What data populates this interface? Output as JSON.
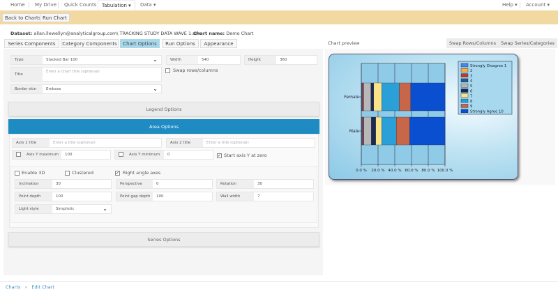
{
  "nav": {
    "items": [
      "Home",
      "My Drive",
      "Quick Counts",
      "Tabulation ▾",
      "Data ▾"
    ],
    "right": [
      "Help ▾",
      "Account ▾"
    ]
  },
  "toolbar": {
    "back": "Back to Charts",
    "run": "Run Chart"
  },
  "info": {
    "dataset_label": "Dataset:",
    "dataset": "allan.llewellyn@analyticalgroup.com\\ TRACKING STUDY DATA WAVE 1.sav",
    "chart_name_label": "Chart name:",
    "chart_name": "Demo Chart"
  },
  "tabs": [
    "Series Components",
    "Category Components",
    "Chart Options",
    "Run Options",
    "Appearance"
  ],
  "form": {
    "type_label": "Type",
    "type_value": "Stacked Bar 100",
    "width_label": "Width",
    "width_value": "540",
    "height_label": "Height",
    "height_value": "360",
    "title_label": "Title",
    "title_placeholder": "Enter a chart title (optional)",
    "swap_label": "Swap rows/columns",
    "border_label": "Border skin",
    "border_value": "Emboss"
  },
  "sections": {
    "legend": "Legend Options",
    "area": "Area Options",
    "series": "Series Options"
  },
  "area": {
    "axis1_label": "Axis 1 title",
    "axis1_placeholder": "Enter a title (optional)",
    "axis2_label": "Axis 2 title",
    "axis2_placeholder": "Enter a title (optional)",
    "ymax_label": "Axis Y maximum",
    "ymax_value": "100",
    "ymin_label": "Axis Y minimum",
    "ymin_value": "0",
    "start_zero_label": "Start axis Y at zero",
    "enable3d": "Enable 3D",
    "clustered": "Clustered",
    "right_angle": "Right angle axes",
    "inclination_label": "Inclination",
    "inclination": "30",
    "perspective_label": "Perspective",
    "perspective": "0",
    "rotation_label": "Rotation",
    "rotation": "30",
    "point_depth_label": "Point depth",
    "point_depth": "100",
    "gap_depth_label": "Point gap depth",
    "gap_depth": "100",
    "wall_width_label": "Wall width",
    "wall_width": "7",
    "light_label": "Light style",
    "light": "Simplistic"
  },
  "preview": {
    "label": "Chart preview",
    "swap_rc": "Swap Rows/Columns",
    "swap_sc": "Swap Series/Categories"
  },
  "breadcrumb": {
    "root": "Charts",
    "sep": "»",
    "current": "Edit Chart"
  },
  "chart_data": {
    "type": "bar",
    "stacked": "100%",
    "orientation": "horizontal",
    "categories": [
      "Female",
      "Male"
    ],
    "xlim": [
      0,
      100
    ],
    "ticks": [
      "0.0 %",
      "20.0 %",
      "40.0 %",
      "60.0 %",
      "80.0 %",
      "100.0 %"
    ],
    "legend_position": "top-right",
    "series": [
      {
        "name": "Strongly Disagree 1",
        "color": "#4a86e8",
        "values": [
          0.5,
          0.5
        ]
      },
      {
        "name": "2",
        "color": "#f5b041",
        "values": [
          0.3,
          0.3
        ]
      },
      {
        "name": "3",
        "color": "#c0392b",
        "values": [
          1.2,
          1.2
        ]
      },
      {
        "name": "4",
        "color": "#1f5f8b",
        "values": [
          0.8,
          1.0
        ]
      },
      {
        "name": "5",
        "color": "#b8b8b8",
        "values": [
          8.7,
          9.0
        ]
      },
      {
        "name": "6",
        "color": "#1b2a4e",
        "values": [
          3.4,
          5.3
        ]
      },
      {
        "name": "7",
        "color": "#fbe38a",
        "values": [
          9.5,
          7.0
        ]
      },
      {
        "name": "8",
        "color": "#2a9fd8",
        "values": [
          21.0,
          17.6
        ]
      },
      {
        "name": "9",
        "color": "#c8664a",
        "values": [
          13.5,
          16.0
        ]
      },
      {
        "name": "Strongly Agree 10",
        "color": "#0b4fd1",
        "values": [
          41.1,
          42.1
        ]
      }
    ]
  }
}
